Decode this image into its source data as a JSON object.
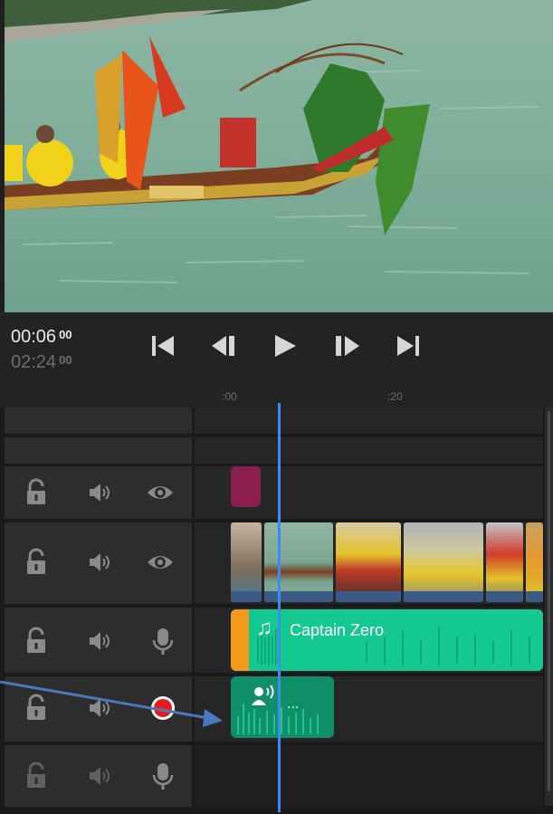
{
  "transport": {
    "current_time": "00:06",
    "current_frames": "00",
    "total_time": "02:24",
    "total_frames": "00",
    "buttons": [
      "go-to-start",
      "step-back",
      "play",
      "step-forward",
      "go-to-end"
    ]
  },
  "ruler": {
    "labels": [
      ":00",
      ":20"
    ]
  },
  "tracks": [
    {
      "name": "empty-track-1"
    },
    {
      "name": "empty-track-2"
    },
    {
      "name": "title-track",
      "controls": [
        "lock-icon",
        "speaker-icon",
        "eye-icon"
      ]
    },
    {
      "name": "video-track",
      "controls": [
        "lock-icon",
        "speaker-icon",
        "eye-icon"
      ]
    },
    {
      "name": "music-track",
      "controls": [
        "lock-icon",
        "speaker-icon",
        "microphone-icon"
      ]
    },
    {
      "name": "voiceover-track",
      "controls": [
        "lock-icon",
        "speaker-icon",
        "record-icon"
      ]
    },
    {
      "name": "audio-track-empty",
      "controls": [
        "lock-icon",
        "speaker-icon",
        "microphone-icon"
      ]
    }
  ],
  "clips": {
    "music": {
      "label": "Captain Zero",
      "icon": "music-note-icon"
    },
    "voiceover": {
      "label": "...",
      "icon": "voiceover-icon"
    }
  },
  "colors": {
    "accent_playhead": "#3c8cf0",
    "audio_clip": "#14c991",
    "voiceover_clip": "#0f8f68",
    "title_clip": "#8a1f4d",
    "record": "#e41c1c",
    "trim_handle": "#f39a1b"
  }
}
